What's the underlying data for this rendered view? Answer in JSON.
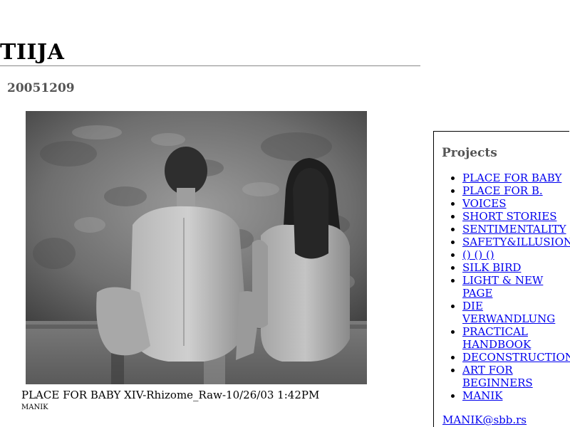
{
  "site": {
    "title": "TIIJA"
  },
  "post": {
    "date": "20051209",
    "image_alt": "Black and white photograph of two nude figures seated with their backs to the viewer",
    "caption": "PLACE FOR BABY XIV-Rhizome_Raw-10/26/03 1:42PM",
    "author": "MANIK"
  },
  "sidebar": {
    "heading": "Projects",
    "items": [
      {
        "label": "PLACE FOR BABY"
      },
      {
        "label": "PLACE FOR B."
      },
      {
        "label": "VOICES"
      },
      {
        "label": "SHORT STORIES"
      },
      {
        "label": "SENTIMENTALITY"
      },
      {
        "label": "SAFETY&ILLUSION"
      },
      {
        "label": "() () ()"
      },
      {
        "label": "SILK BIRD"
      },
      {
        "label": "LIGHT & NEW PAGE"
      },
      {
        "label": "DIE VERWANDLUNG"
      },
      {
        "label": "PRACTICAL HANDBOOK"
      },
      {
        "label": "DECONSTRUCTION"
      },
      {
        "label": "ART FOR BEGINNERS"
      },
      {
        "label": "MANIK"
      }
    ],
    "email": "MANIK@sbb.rs"
  },
  "colors": {
    "link": "#0000ee",
    "heading_gray": "#555555",
    "rule": "#888888"
  }
}
